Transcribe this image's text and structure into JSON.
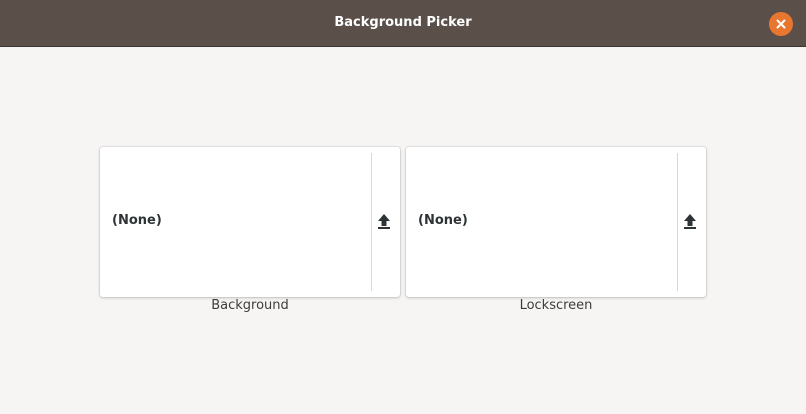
{
  "window": {
    "title": "Background Picker"
  },
  "background_card": {
    "value": "(None)",
    "caption": "Background",
    "upload_icon": "upload-arrow-icon"
  },
  "lockscreen_card": {
    "value": "(None)",
    "caption": "Lockscreen",
    "upload_icon": "upload-arrow-icon"
  },
  "colors": {
    "titlebar": "#5a5049",
    "close_button": "#e9762e",
    "window_background": "#f6f5f4",
    "card_background": "#ffffff"
  }
}
